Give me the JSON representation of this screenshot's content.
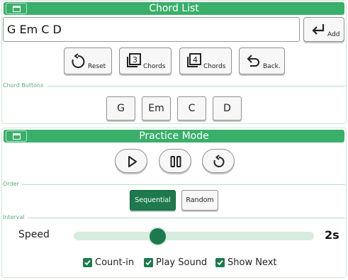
{
  "chord_panel": {
    "title": "Chord List",
    "input_value": "G Em C D",
    "add_label": "Add",
    "controls": [
      {
        "icon": "reset-icon",
        "label": "Reset"
      },
      {
        "icon": "three-chords-icon",
        "label": "Chords"
      },
      {
        "icon": "four-chords-icon",
        "label": "Chords"
      },
      {
        "icon": "back-arrow-icon",
        "label": "Back."
      }
    ],
    "chord_buttons_label": "Chord Buttons",
    "chord_buttons": [
      "G",
      "Em",
      "C",
      "D"
    ]
  },
  "practice_panel": {
    "title": "Practice Mode",
    "transport": [
      {
        "icon": "play-icon"
      },
      {
        "icon": "pause-icon"
      },
      {
        "icon": "restart-icon"
      }
    ],
    "order_label": "Order",
    "order_options": [
      "Sequential",
      "Random"
    ],
    "order_selected": "Sequential",
    "interval_label": "Interval",
    "speed_label": "Speed",
    "speed_value": "2s",
    "speed_slider_fraction": 0.35,
    "options": [
      {
        "label": "Count-in",
        "checked": true
      },
      {
        "label": "Play Sound",
        "checked": true
      },
      {
        "label": "Show Next",
        "checked": true
      }
    ]
  },
  "colors": {
    "accent": "#3aaf6a",
    "accent_dark": "#1e7a4e",
    "track": "#d6ecde"
  }
}
